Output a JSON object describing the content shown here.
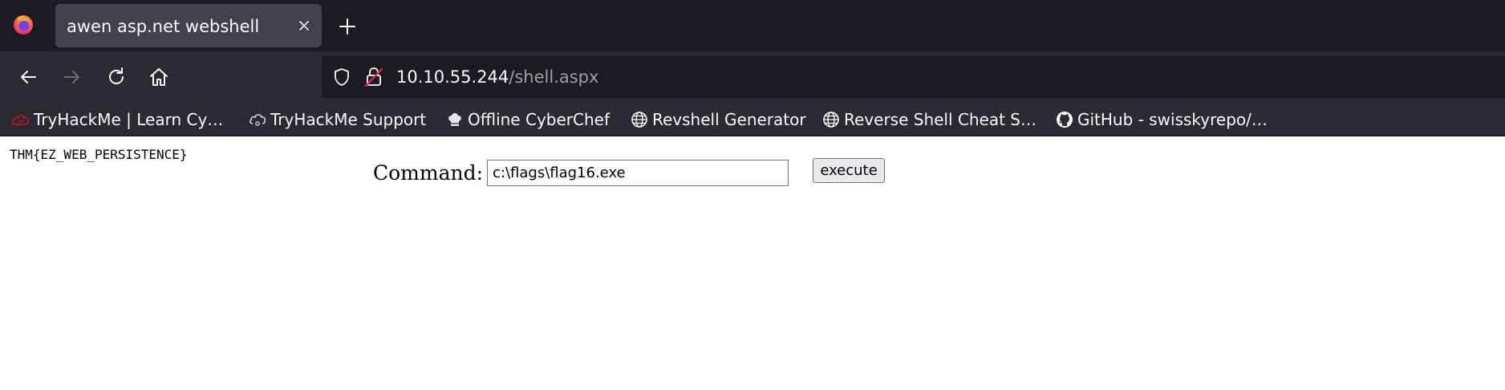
{
  "browser": {
    "tab": {
      "title": "awen asp.net webshell"
    },
    "url": {
      "host": "10.10.55.244",
      "path": "/shell.aspx"
    },
    "bookmarks": [
      {
        "label": "TryHackMe | Learn Cy…",
        "icon": "tryhackme-icon"
      },
      {
        "label": "TryHackMe Support",
        "icon": "cloud-support-icon"
      },
      {
        "label": "Offline CyberChef",
        "icon": "chef-hat-icon"
      },
      {
        "label": "Revshell Generator",
        "icon": "globe-icon"
      },
      {
        "label": "Reverse Shell Cheat S…",
        "icon": "globe-icon"
      },
      {
        "label": "GitHub - swisskyrepo/…",
        "icon": "github-icon"
      }
    ]
  },
  "page": {
    "flag": "THM{EZ_WEB_PERSISTENCE}",
    "command_label": "Command:",
    "command_value": "c:\\flags\\flag16.exe",
    "execute_label": "execute"
  },
  "colors": {
    "tab_strip": "#1c1b22",
    "toolbar": "#2b2a33",
    "active_tab": "#42414d",
    "url_path": "#9e9ea6",
    "tryhackme_red": "#c11111"
  }
}
